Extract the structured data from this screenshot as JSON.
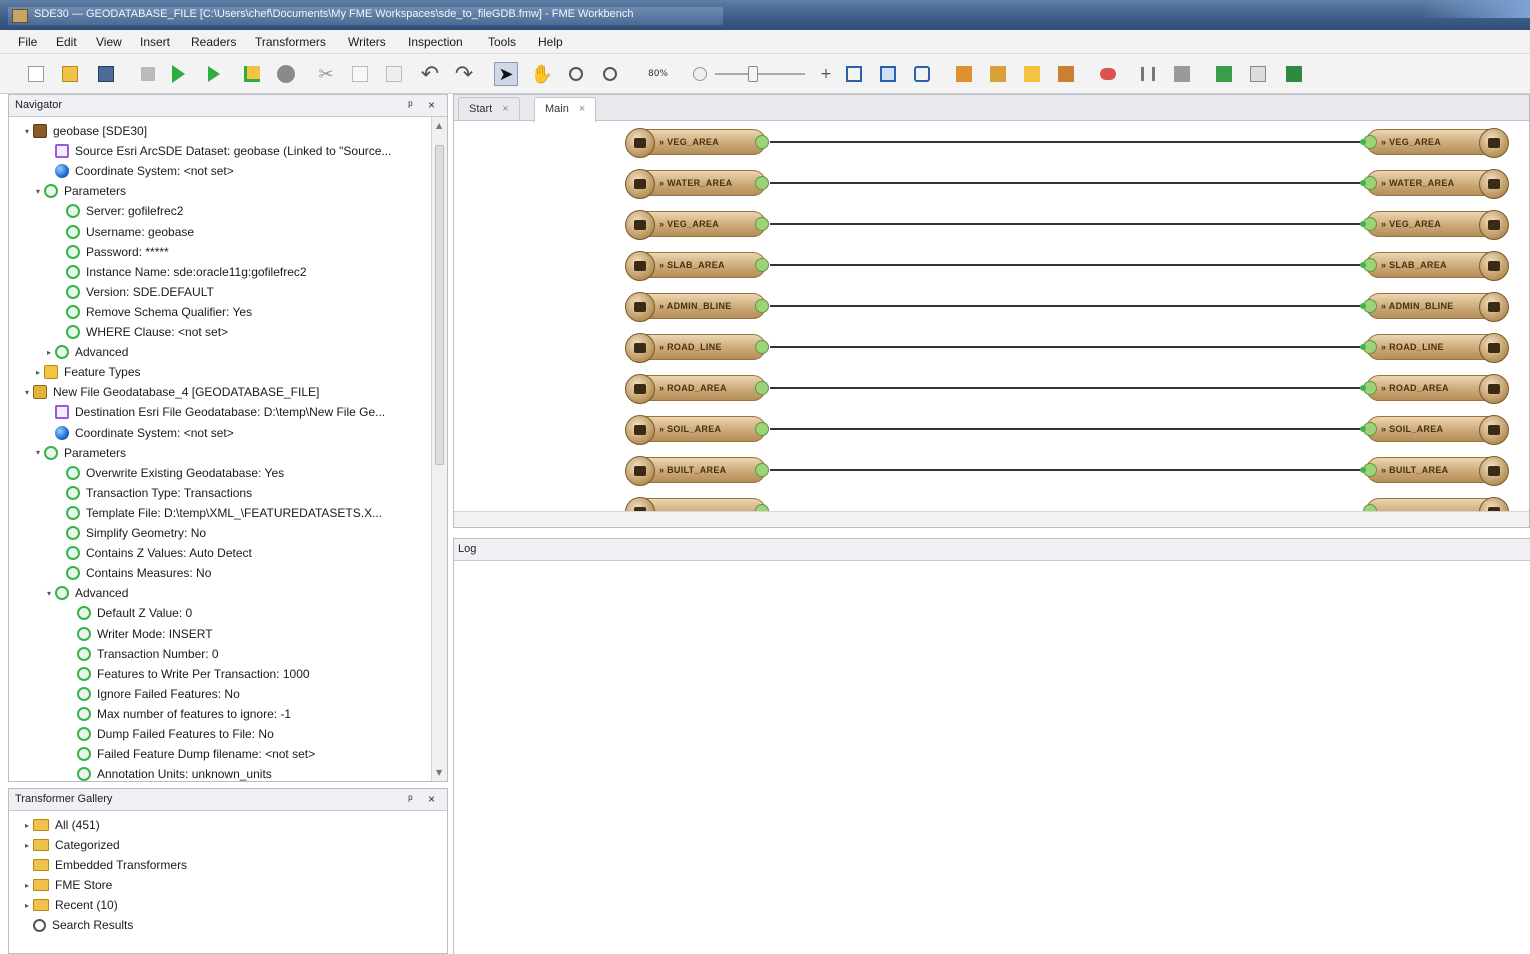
{
  "window": {
    "title": "SDE30 — GEODATABASE_FILE [C:\\Users\\chef\\Documents\\My FME Workspaces\\sde_to_fileGDB.fmw] - FME Workbench"
  },
  "menu": [
    "File",
    "Edit",
    "View",
    "Insert",
    "Readers",
    "Transformers",
    "Writers",
    "Inspection",
    "Tools",
    "Help"
  ],
  "toolbar": {
    "zoom_value": "80%",
    "icons": [
      "new-icon",
      "open-icon",
      "save-icon",
      "stop-icon",
      "run-icon",
      "run-to-icon",
      "inspect-icon",
      "record-icon",
      "cut-icon",
      "copy-icon",
      "paste-icon",
      "undo-icon",
      "redo-icon",
      "select-icon",
      "pan-icon",
      "zoom-in-icon",
      "zoom-out-icon"
    ],
    "right_icons": [
      "zoom-fit-icon",
      "zoom-selection-icon",
      "refresh-icon",
      "add-reader-icon",
      "add-writer-icon",
      "add-feature-type-icon",
      "add-transformer-icon",
      "connect-icon",
      "align-icon",
      "distribute-icon",
      "group-icon",
      "table-icon",
      "bookmark-icon"
    ]
  },
  "navigator": {
    "title": "Navigator",
    "items": [
      {
        "label": "geobase [SDE30]",
        "icon": "db",
        "indent": 0,
        "exp": "▾"
      },
      {
        "label": "Source Esri ArcSDE Dataset: geobase (Linked to \"Source...",
        "icon": "dataset",
        "indent": 2,
        "exp": ""
      },
      {
        "label": "Coordinate System: <not set>",
        "icon": "globe",
        "indent": 2,
        "exp": ""
      },
      {
        "label": "Parameters",
        "icon": "param",
        "indent": 1,
        "exp": "▾"
      },
      {
        "label": "Server: gofilefrec2",
        "icon": "param",
        "indent": 3,
        "exp": ""
      },
      {
        "label": "Username: geobase",
        "icon": "param",
        "indent": 3,
        "exp": ""
      },
      {
        "label": "Password: *****",
        "icon": "param",
        "indent": 3,
        "exp": ""
      },
      {
        "label": "Instance Name: sde:oracle11g:gofilefrec2",
        "icon": "param",
        "indent": 3,
        "exp": ""
      },
      {
        "label": "Version: SDE.DEFAULT",
        "icon": "param",
        "indent": 3,
        "exp": ""
      },
      {
        "label": "Remove Schema Qualifier: Yes",
        "icon": "param",
        "indent": 3,
        "exp": ""
      },
      {
        "label": "WHERE Clause: <not set>",
        "icon": "param",
        "indent": 3,
        "exp": ""
      },
      {
        "label": "Advanced",
        "icon": "param",
        "indent": 2,
        "exp": "▸"
      },
      {
        "label": "Feature Types",
        "icon": "feature",
        "indent": 1,
        "exp": "▸"
      },
      {
        "label": "New File Geodatabase_4 [GEODATABASE_FILE]",
        "icon": "gdb",
        "indent": 0,
        "exp": "▾"
      },
      {
        "label": "Destination Esri File Geodatabase: D:\\temp\\New File Ge...",
        "icon": "dataset",
        "indent": 2,
        "exp": ""
      },
      {
        "label": "Coordinate System: <not set>",
        "icon": "globe",
        "indent": 2,
        "exp": ""
      },
      {
        "label": "Parameters",
        "icon": "param",
        "indent": 1,
        "exp": "▾"
      },
      {
        "label": "Overwrite Existing Geodatabase: Yes",
        "icon": "param",
        "indent": 3,
        "exp": ""
      },
      {
        "label": "Transaction Type: Transactions",
        "icon": "param",
        "indent": 3,
        "exp": ""
      },
      {
        "label": "Template File: D:\\temp\\XML_\\FEATUREDATASETS.X...",
        "icon": "param",
        "indent": 3,
        "exp": ""
      },
      {
        "label": "Simplify Geometry: No",
        "icon": "param",
        "indent": 3,
        "exp": ""
      },
      {
        "label": "Contains Z Values: Auto Detect",
        "icon": "param",
        "indent": 3,
        "exp": ""
      },
      {
        "label": "Contains Measures: No",
        "icon": "param",
        "indent": 3,
        "exp": ""
      },
      {
        "label": "Advanced",
        "icon": "param",
        "indent": 2,
        "exp": "▾"
      },
      {
        "label": "Default Z Value: 0",
        "icon": "param",
        "indent": 4,
        "exp": ""
      },
      {
        "label": "Writer Mode: INSERT",
        "icon": "param",
        "indent": 4,
        "exp": ""
      },
      {
        "label": "Transaction Number: 0",
        "icon": "param",
        "indent": 4,
        "exp": ""
      },
      {
        "label": "Features to Write Per Transaction: 1000",
        "icon": "param",
        "indent": 4,
        "exp": ""
      },
      {
        "label": "Ignore Failed Features: No",
        "icon": "param",
        "indent": 4,
        "exp": ""
      },
      {
        "label": "Max number of features to ignore: -1",
        "icon": "param",
        "indent": 4,
        "exp": ""
      },
      {
        "label": "Dump Failed Features to File: No",
        "icon": "param",
        "indent": 4,
        "exp": ""
      },
      {
        "label": "Failed Feature Dump filename: <not set>",
        "icon": "param",
        "indent": 4,
        "exp": ""
      },
      {
        "label": "Annotation Units: unknown_units",
        "icon": "param",
        "indent": 4,
        "exp": ""
      }
    ]
  },
  "gallery": {
    "title": "Transformer Gallery",
    "items": [
      {
        "label": "All (451)",
        "icon": "folder",
        "exp": "▸"
      },
      {
        "label": "Categorized",
        "icon": "folder",
        "exp": "▸"
      },
      {
        "label": "Embedded Transformers",
        "icon": "folder",
        "exp": ""
      },
      {
        "label": "FME Store",
        "icon": "folder",
        "exp": "▸"
      },
      {
        "label": "Recent (10)",
        "icon": "folder",
        "exp": "▸"
      },
      {
        "label": "Search Results",
        "icon": "search",
        "exp": ""
      }
    ]
  },
  "tabs": [
    {
      "label": "Start",
      "close": "×"
    },
    {
      "label": "Main",
      "close": "×"
    }
  ],
  "connections": {
    "sources": [
      "VEG_AREA",
      "WATER_AREA",
      "VEG_AREA",
      "SLAB_AREA",
      "ADMIN_BLINE",
      "ROAD_LINE",
      "ROAD_AREA",
      "SOIL_AREA",
      "BUILT_AREA"
    ],
    "destinations": [
      "VEG_AREA",
      "WATER_AREA",
      "VEG_AREA",
      "SLAB_AREA",
      "ADMIN_BLINE",
      "ROAD_LINE",
      "ROAD_AREA",
      "SOIL_AREA",
      "BUILT_AREA"
    ]
  },
  "log": {
    "title": "Log"
  }
}
